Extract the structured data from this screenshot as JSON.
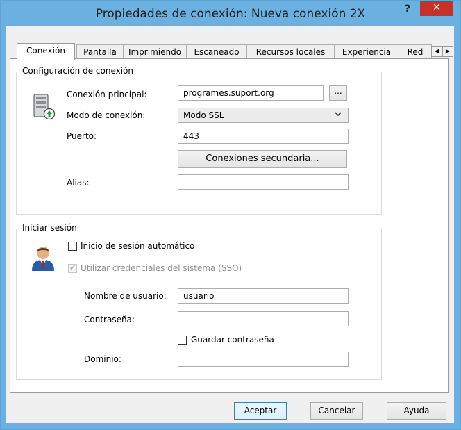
{
  "window": {
    "title": "Propiedades de conexión: Nueva conexión 2X",
    "help_label": "?",
    "close_label": "✕"
  },
  "tabs": {
    "items": [
      {
        "label": "Conexión"
      },
      {
        "label": "Pantalla"
      },
      {
        "label": "Imprimiendo"
      },
      {
        "label": "Escaneado"
      },
      {
        "label": "Recursos locales"
      },
      {
        "label": "Experiencia"
      },
      {
        "label": "Red"
      }
    ],
    "scroll_left": "◀",
    "scroll_right": "▶"
  },
  "connection_config": {
    "legend": "Configuración de conexión",
    "icon": "server-icon",
    "main_label": "Conexión principal:",
    "main_value": "programes.suport.org",
    "browse_label": "...",
    "mode_label": "Modo de conexión:",
    "mode_value": "Modo SSL",
    "port_label": "Puerto:",
    "port_value": "443",
    "secondary_button": "Conexiones secundaria...",
    "alias_label": "Alias:",
    "alias_value": ""
  },
  "login": {
    "legend": "Iniciar sesión",
    "icon": "user-icon",
    "auto_login_label": "Inicio de sesión automático",
    "sso_label": "Utilizar credenciales del sistema (SSO)",
    "username_label": "Nombre de usuario:",
    "username_value": "usuario",
    "password_label": "Contraseña:",
    "password_value": "",
    "save_password_label": "Guardar contraseña",
    "domain_label": "Dominio:",
    "domain_value": ""
  },
  "buttons": {
    "accept": "Aceptar",
    "cancel": "Cancelar",
    "help": "Ayuda"
  }
}
